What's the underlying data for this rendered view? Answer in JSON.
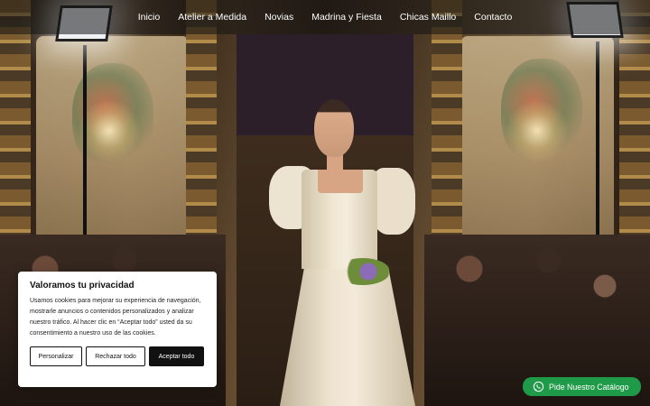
{
  "nav": {
    "items": [
      {
        "label": "Inicio"
      },
      {
        "label": "Atelier a Medida"
      },
      {
        "label": "Novias"
      },
      {
        "label": "Madrina y Fiesta"
      },
      {
        "label": "Chicas Maillo"
      },
      {
        "label": "Contacto"
      }
    ]
  },
  "cookie": {
    "title": "Valoramos tu privacidad",
    "text": "Usamos cookies para mejorar su experiencia de navegación, mostrarle anuncios o contenidos personalizados y analizar nuestro tráfico. Al hacer clic en “Aceptar todo” usted da su consentimiento a nuestro uso de las cookies.",
    "customize_label": "Personalizar",
    "reject_label": "Rechazar todo",
    "accept_label": "Aceptar todo"
  },
  "whatsapp": {
    "label": "Pide Nuestro Catálogo",
    "icon": "whatsapp-icon",
    "color": "#1f9a48"
  },
  "hero": {
    "image": "bride-runway-photo"
  }
}
